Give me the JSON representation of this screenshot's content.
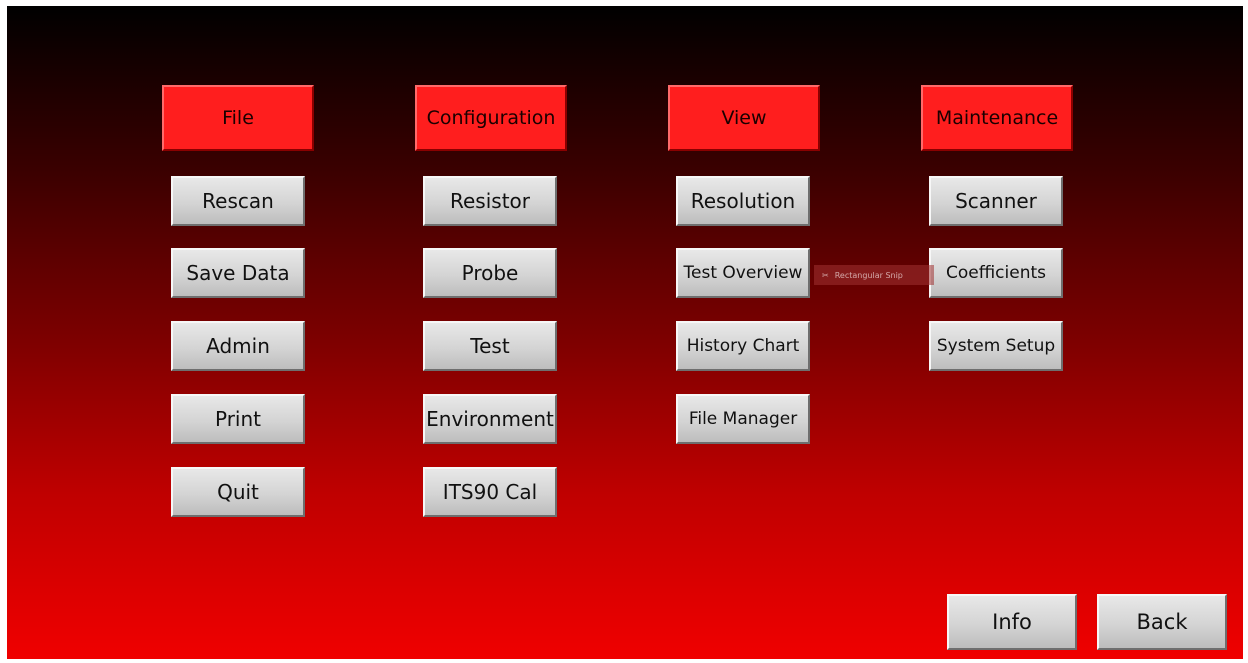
{
  "menus": [
    {
      "header": "File",
      "items": [
        "Rescan",
        "Save Data",
        "Admin",
        "Print",
        "Quit"
      ]
    },
    {
      "header": "Configuration",
      "items": [
        "Resistor",
        "Probe",
        "Test",
        "Environment",
        "ITS90 Cal"
      ]
    },
    {
      "header": "View",
      "items": [
        "Resolution",
        "Test Overview",
        "History Chart",
        "File Manager"
      ]
    },
    {
      "header": "Maintenance",
      "items": [
        "Scanner",
        "Coefficients",
        "System Setup"
      ]
    }
  ],
  "footer": {
    "info_label": "Info",
    "back_label": "Back"
  },
  "overlay": {
    "snip_label": "Rectangular Snip",
    "snip_icon": "scissors-icon"
  },
  "colors": {
    "header_button": "#ff1e1e",
    "button_face": "#d4d4d4",
    "background_top": "#000000",
    "background_bottom": "#f00000"
  }
}
